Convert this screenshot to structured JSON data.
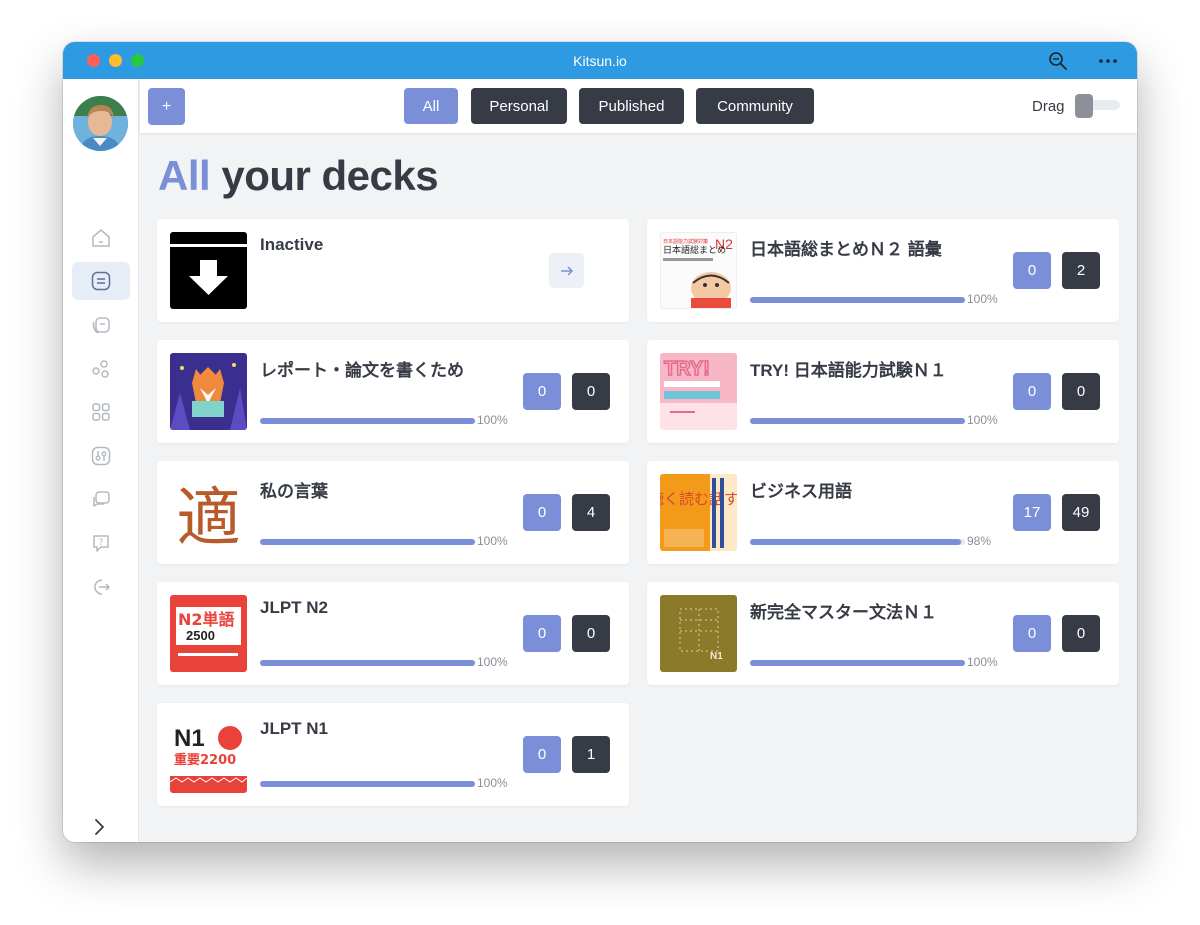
{
  "window": {
    "title": "Kitsun.io"
  },
  "toolbar": {
    "add_label": "+",
    "tabs": [
      "All",
      "Personal",
      "Published",
      "Community"
    ],
    "drag_label": "Drag"
  },
  "heading": {
    "accent": "All",
    "rest": " your decks"
  },
  "colors": {
    "accent": "#7b8fd9",
    "dark": "#363b45",
    "titlebar": "#2e9ae2"
  },
  "inactive": {
    "title": "Inactive",
    "icon": "archive-download-icon",
    "action_icon": "arrow-right-icon"
  },
  "decks": [
    {
      "title": "日本語総まとめＮ２ 語彙",
      "progress": 100,
      "progress_label": "100%",
      "new": "0",
      "review": "2",
      "cover_text": "N2",
      "cover_sub": "日本語総まとめ"
    },
    {
      "title": "レポート・論文を書くため",
      "progress": 100,
      "progress_label": "100%",
      "new": "0",
      "review": "0"
    },
    {
      "title": "TRY! 日本語能力試験Ｎ１",
      "progress": 100,
      "progress_label": "100%",
      "new": "0",
      "review": "0",
      "cover_text": "TRY!"
    },
    {
      "title": "私の言葉",
      "progress": 100,
      "progress_label": "100%",
      "new": "0",
      "review": "4",
      "cover_text": "適"
    },
    {
      "title": "ビジネス用語",
      "progress": 98,
      "progress_label": "98%",
      "new": "17",
      "review": "49",
      "cover_text": "聴く読む話す"
    },
    {
      "title": "JLPT N2",
      "progress": 100,
      "progress_label": "100%",
      "new": "0",
      "review": "0",
      "cover_text": "N2単語",
      "cover_sub": "2500"
    },
    {
      "title": "新完全マスター文法Ｎ１",
      "progress": 100,
      "progress_label": "100%",
      "new": "0",
      "review": "0",
      "cover_text": "N1"
    },
    {
      "title": "JLPT N1",
      "progress": 100,
      "progress_label": "100%",
      "new": "0",
      "review": "1",
      "cover_text": "N1",
      "cover_sub": "重要2200"
    }
  ]
}
